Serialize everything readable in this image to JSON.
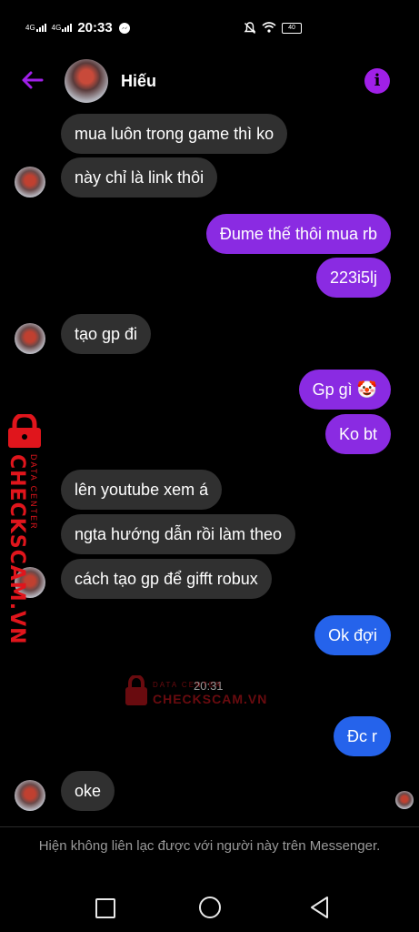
{
  "status_bar": {
    "network1": "4G",
    "network2": "4G",
    "time": "20:33",
    "battery": "40"
  },
  "header": {
    "contact_name": "Hiếu",
    "icons": [
      "back-arrow-icon",
      "info-icon"
    ],
    "accent_color": "#a020e8"
  },
  "messages": [
    {
      "side": "in",
      "text": "mua luôn trong game thì ko"
    },
    {
      "side": "in",
      "text": "này chỉ là link thôi"
    },
    {
      "side": "out",
      "text": "Đume thế thôi mua rb"
    },
    {
      "side": "out",
      "text": "223i5lj"
    },
    {
      "side": "in",
      "text": "tạo gp đi"
    },
    {
      "side": "out",
      "text": "Gp gì 🤡"
    },
    {
      "side": "out",
      "text": "Ko bt"
    },
    {
      "side": "in",
      "text": "lên youtube xem á"
    },
    {
      "side": "in",
      "text": "ngta hướng dẫn rồi làm theo"
    },
    {
      "side": "in",
      "text": "cách tạo gp để gifft robux"
    },
    {
      "side": "out",
      "text": "Ok đợi"
    },
    {
      "side": "out",
      "text": "Đc r"
    },
    {
      "side": "in",
      "text": "oke"
    }
  ],
  "timestamp": "20:31",
  "watermark": {
    "brand": "CHECKSCAM.VN",
    "subtitle": "DATA CENTER"
  },
  "footer_notice": "Hiện không liên lạc được với người này trên Messenger.",
  "colors": {
    "incoming_bubble": "#303030",
    "outgoing_purple": "#8a2be2",
    "outgoing_blue": "#2563eb"
  }
}
